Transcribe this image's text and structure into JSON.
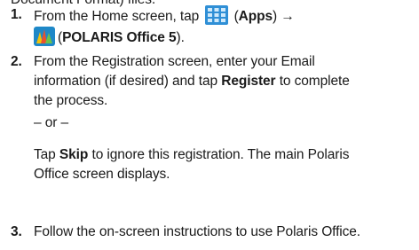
{
  "clipped_heading": "Document Format) files.",
  "steps": [
    {
      "number": "1.",
      "line1_pre": "From the Home screen, tap",
      "apps_label": "Apps",
      "arrow": "→",
      "polaris_label": "POLARIS Office 5"
    },
    {
      "number": "2.",
      "line1": "From the Registration screen, enter your Email",
      "line2_pre": "information (if desired) and tap",
      "register_label": "Register",
      "line2_post": "to complete",
      "line3": "the process.",
      "or_text": "– or –",
      "skip_pre": "Tap",
      "skip_label": "Skip",
      "skip_post": "to ignore this registration. The main Polaris",
      "skip_line2": "Office screen displays."
    },
    {
      "number": "3.",
      "line1": "Follow the on-screen instructions to use Polaris Office."
    }
  ],
  "icons": {
    "apps": "apps-grid-icon",
    "polaris": "polaris-office-icon"
  },
  "colors": {
    "apps_icon": "#2f8fd6",
    "text": "#1a1a1a"
  }
}
